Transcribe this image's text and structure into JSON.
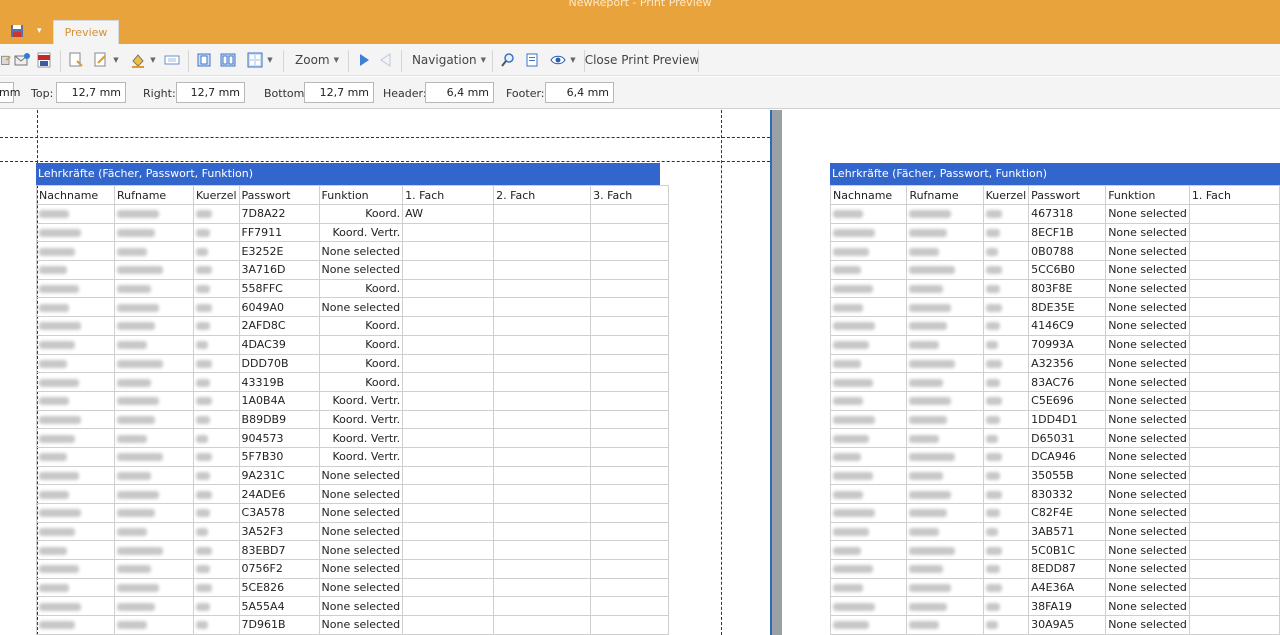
{
  "window": {
    "title": "NewReport - Print Preview",
    "tab": "Preview",
    "qa_arrow": "▾"
  },
  "toolbar": {
    "zoom_label": "Zoom",
    "navigation_label": "Navigation",
    "close_label": "Close Print Preview"
  },
  "margins": {
    "left_unit": "mm",
    "top_label": "Top:",
    "top_value": "12,7 mm",
    "right_label": "Right:",
    "right_value": "12,7 mm",
    "bottom_label": "Bottom:",
    "bottom_value": "12,7 mm",
    "header_label": "Header:",
    "header_value": "6,4 mm",
    "footer_label": "Footer:",
    "footer_value": "6,4 mm"
  },
  "report_left": {
    "title": "Lehrkräfte (Fächer, Passwort, Funktion)",
    "headers": [
      "Nachname",
      "Rufname",
      "Kuerzel",
      "Passwort",
      "Funktion",
      "1. Fach",
      "2. Fach",
      "3. Fach"
    ],
    "rows": [
      {
        "pw": "7D8A22",
        "fn": "Koord.",
        "f1": "AW"
      },
      {
        "pw": "FF7911",
        "fn": "Koord. Vertr.",
        "f1": ""
      },
      {
        "pw": "E3252E",
        "fn": "None selected",
        "f1": ""
      },
      {
        "pw": "3A716D",
        "fn": "None selected",
        "f1": ""
      },
      {
        "pw": "558FFC",
        "fn": "Koord.",
        "f1": ""
      },
      {
        "pw": "6049A0",
        "fn": "None selected",
        "f1": ""
      },
      {
        "pw": "2AFD8C",
        "fn": "Koord.",
        "f1": ""
      },
      {
        "pw": "4DAC39",
        "fn": "Koord.",
        "f1": ""
      },
      {
        "pw": "DDD70B",
        "fn": "Koord.",
        "f1": ""
      },
      {
        "pw": "43319B",
        "fn": "Koord.",
        "f1": ""
      },
      {
        "pw": "1A0B4A",
        "fn": "Koord. Vertr.",
        "f1": ""
      },
      {
        "pw": "B89DB9",
        "fn": "Koord. Vertr.",
        "f1": ""
      },
      {
        "pw": "904573",
        "fn": "Koord. Vertr.",
        "f1": ""
      },
      {
        "pw": "5F7B30",
        "fn": "Koord. Vertr.",
        "f1": ""
      },
      {
        "pw": "9A231C",
        "fn": "None selected",
        "f1": ""
      },
      {
        "pw": "24ADE6",
        "fn": "None selected",
        "f1": ""
      },
      {
        "pw": "C3A578",
        "fn": "None selected",
        "f1": ""
      },
      {
        "pw": "3A52F3",
        "fn": "None selected",
        "f1": ""
      },
      {
        "pw": "83EBD7",
        "fn": "None selected",
        "f1": ""
      },
      {
        "pw": "0756F2",
        "fn": "None selected",
        "f1": ""
      },
      {
        "pw": "5CE826",
        "fn": "None selected",
        "f1": ""
      },
      {
        "pw": "5A55A4",
        "fn": "None selected",
        "f1": ""
      },
      {
        "pw": "7D961B",
        "fn": "None selected",
        "f1": ""
      }
    ]
  },
  "report_right": {
    "title": "Lehrkräfte (Fächer, Passwort, Funktion)",
    "headers": [
      "Nachname",
      "Rufname",
      "Kuerzel",
      "Passwort",
      "Funktion",
      "1. Fach"
    ],
    "rows": [
      {
        "pw": "467318",
        "fn": "None selected"
      },
      {
        "pw": "8ECF1B",
        "fn": "None selected"
      },
      {
        "pw": "0B0788",
        "fn": "None selected"
      },
      {
        "pw": "5CC6B0",
        "fn": "None selected"
      },
      {
        "pw": "803F8E",
        "fn": "None selected"
      },
      {
        "pw": "8DE35E",
        "fn": "None selected"
      },
      {
        "pw": "4146C9",
        "fn": "None selected"
      },
      {
        "pw": "70993A",
        "fn": "None selected"
      },
      {
        "pw": "A32356",
        "fn": "None selected"
      },
      {
        "pw": "83AC76",
        "fn": "None selected"
      },
      {
        "pw": "C5E696",
        "fn": "None selected"
      },
      {
        "pw": "1DD4D1",
        "fn": "None selected"
      },
      {
        "pw": "D65031",
        "fn": "None selected"
      },
      {
        "pw": "DCA946",
        "fn": "None selected"
      },
      {
        "pw": "35055B",
        "fn": "None selected"
      },
      {
        "pw": "830332",
        "fn": "None selected"
      },
      {
        "pw": "C82F4E",
        "fn": "None selected"
      },
      {
        "pw": "3AB571",
        "fn": "None selected"
      },
      {
        "pw": "5C0B1C",
        "fn": "None selected"
      },
      {
        "pw": "8EDD87",
        "fn": "None selected"
      },
      {
        "pw": "A4E36A",
        "fn": "None selected"
      },
      {
        "pw": "38FA19",
        "fn": "None selected"
      },
      {
        "pw": "30A9A5",
        "fn": "None selected"
      }
    ]
  },
  "colors": {
    "titlebar": "#e8a33c",
    "report_header": "#3366cc",
    "page_border": "#2d6bb5"
  },
  "icons": [
    "pdf-icon",
    "save-icon",
    "export-icon",
    "email-icon",
    "fill-color-icon",
    "watermark-icon",
    "single-page-icon",
    "two-pages-icon",
    "multi-page-icon",
    "next-page-icon",
    "previous-page-icon",
    "hand-tool-icon",
    "magnifier-icon",
    "eye-icon"
  ]
}
